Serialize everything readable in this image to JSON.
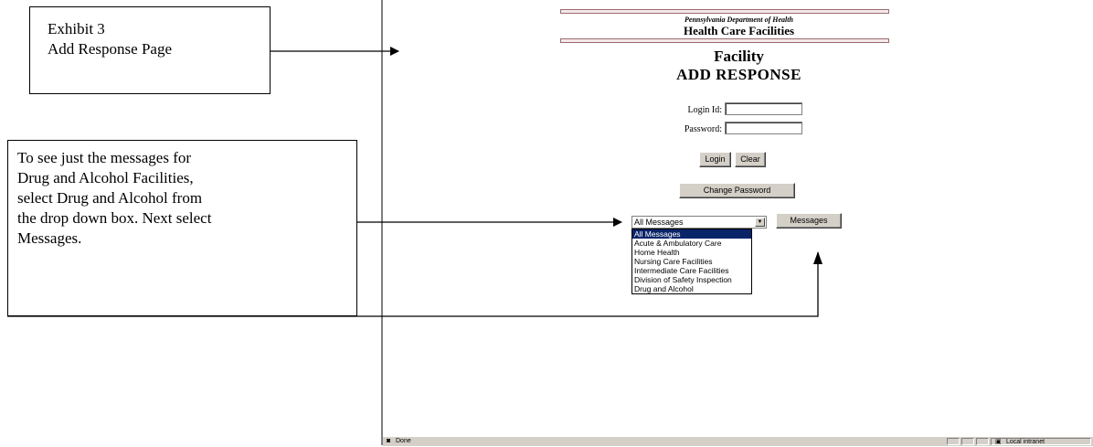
{
  "exhibit": {
    "line1": "Exhibit 3",
    "line2": "Add Response Page"
  },
  "instructions": {
    "lines": [
      "To see just the messages for",
      "Drug and Alcohol Facilities,",
      "select Drug and Alcohol from",
      "the drop down box.  Next select",
      "Messages."
    ]
  },
  "page": {
    "department": "Pennsylvania Department of Health",
    "subtitle": "Health Care Facilities",
    "title_line1": "Facility",
    "title_line2": "ADD RESPONSE",
    "login_label": "Login Id:",
    "password_label": "Password:",
    "login_value": "",
    "password_value": ""
  },
  "buttons": {
    "login": "Login",
    "clear": "Clear",
    "change_password": "Change Password",
    "messages": "Messages"
  },
  "dropdown": {
    "selected": "All Messages",
    "options": [
      "All Messages",
      "Acute & Ambulatory Care",
      "Home Health",
      "Nursing Care Facilities",
      "Intermediate Care Facilities",
      "Division of Safety Inspection",
      "Drug and Alcohol"
    ]
  },
  "status_bar": {
    "status": "Done",
    "zone": "Local intranet"
  },
  "colors": {
    "header_rule": "#9b6a72",
    "selected_bg": "#0a246a",
    "button_face": "#d4d0c8"
  }
}
